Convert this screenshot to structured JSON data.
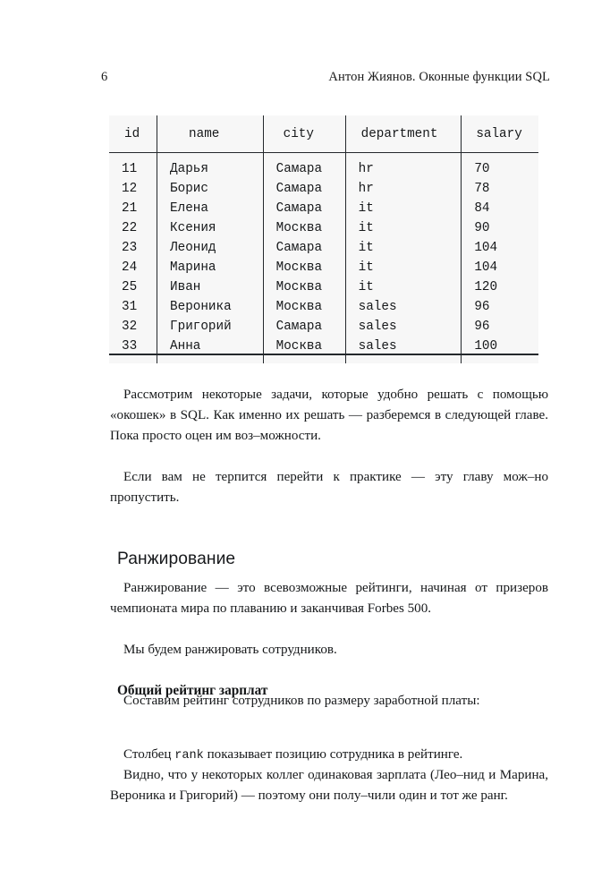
{
  "header": {
    "folio": "6",
    "running_title": "Антон Жиянов. Оконные функции SQL"
  },
  "table": {
    "columns": [
      "id",
      "name",
      "city",
      "department",
      "salary"
    ],
    "rows": [
      {
        "id": "11",
        "name": "Дарья",
        "city": "Самара",
        "department": "hr",
        "salary": "70"
      },
      {
        "id": "12",
        "name": "Борис",
        "city": "Самара",
        "department": "hr",
        "salary": "78"
      },
      {
        "id": "21",
        "name": "Елена",
        "city": "Самара",
        "department": "it",
        "salary": "84"
      },
      {
        "id": "22",
        "name": "Ксения",
        "city": "Москва",
        "department": "it",
        "salary": "90"
      },
      {
        "id": "23",
        "name": "Леонид",
        "city": "Самара",
        "department": "it",
        "salary": "104"
      },
      {
        "id": "24",
        "name": "Марина",
        "city": "Москва",
        "department": "it",
        "salary": "104"
      },
      {
        "id": "25",
        "name": "Иван",
        "city": "Москва",
        "department": "it",
        "salary": "120"
      },
      {
        "id": "31",
        "name": "Вероника",
        "city": "Москва",
        "department": "sales",
        "salary": "96"
      },
      {
        "id": "32",
        "name": "Григорий",
        "city": "Самара",
        "department": "sales",
        "salary": "96"
      },
      {
        "id": "33",
        "name": "Анна",
        "city": "Москва",
        "department": "sales",
        "salary": "100"
      }
    ]
  },
  "content": {
    "para_1": "Рассмотрим некоторые задачи, которые удобно решать с помощью «окошек» в SQL. Как именно их решать — разберемся в следующей главе. Пока просто оцен им воз–можности.",
    "para_2": "Если вам не терпится перейти к практике — эту главу мож–но пропустить.",
    "section_heading": "Ранжирование",
    "para_3": "Ранжирование — это всевозможные рейтинги, начиная от призеров чемпионата мира по плаванию и заканчивая Forbes 500.",
    "para_4": "Мы будем ранжировать сотрудников.",
    "sub_heading": "Общий рейтинг зарплат",
    "para_5": "Составим рейтинг сотрудников по размеру заработной платы:",
    "para_6_before": "Столбец ",
    "para_6_code": "rank",
    "para_6_after": " показывает позицию сотрудника в рейтинге.",
    "para_7": "Видно, что у некоторых коллег одинаковая зарплата (Лео–нид и Марина, Вероника и Григорий) — поэтому они полу–чили один и тот же ранг."
  }
}
